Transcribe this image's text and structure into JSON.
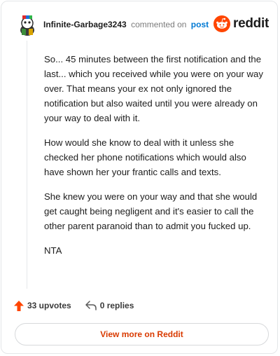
{
  "comment": {
    "username": "Infinite-Garbage3243",
    "action_text": "commented on",
    "post_link": "post",
    "brand": "reddit",
    "paragraphs": [
      "So... 45 minutes between the first notification and the last... which you received while you were on your way over. That means your ex not only ignored the notification but also waited until you were already on your way to deal with it.",
      "How would she know to deal with it unless she checked her phone notifications which would also have shown her your frantic calls and texts.",
      "She knew you were on your way and that she would get caught being negligent and it's easier to call the other parent paranoid than to admit you fucked up.",
      "NTA"
    ],
    "upvotes": "33 upvotes",
    "replies": "0 replies"
  },
  "footer": {
    "view_more": "View more on Reddit"
  },
  "colors": {
    "accent": "#d93a00",
    "link": "#0079d3",
    "reddit_orange": "#ff4500"
  }
}
